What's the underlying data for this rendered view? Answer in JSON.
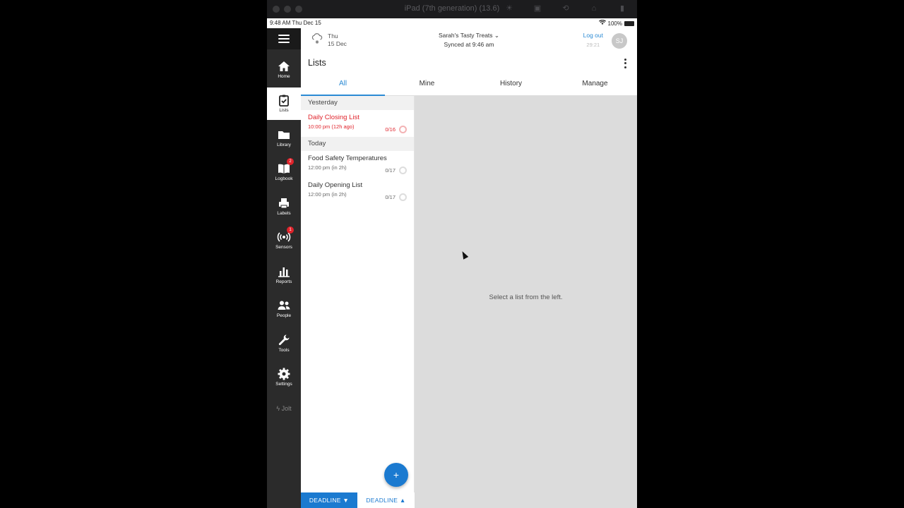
{
  "window": {
    "title": "iPad (7th generation) (13.6)"
  },
  "statusbar": {
    "time_date": "9:48 AM  Thu Dec 15",
    "battery": "100%"
  },
  "sidebar": {
    "items": [
      {
        "label": "Home",
        "icon": "home-icon"
      },
      {
        "label": "Lists",
        "icon": "clipboard-check-icon"
      },
      {
        "label": "Library",
        "icon": "folder-icon"
      },
      {
        "label": "Logbook",
        "icon": "book-icon",
        "badge": "2"
      },
      {
        "label": "Labels",
        "icon": "printer-icon"
      },
      {
        "label": "Sensors",
        "icon": "sensor-icon",
        "badge": "1"
      },
      {
        "label": "Reports",
        "icon": "bar-chart-icon"
      },
      {
        "label": "People",
        "icon": "people-icon"
      },
      {
        "label": "Tools",
        "icon": "wrench-icon"
      },
      {
        "label": "Settings",
        "icon": "gear-icon"
      }
    ],
    "brand": "Jolt"
  },
  "topbar": {
    "day": "Thu",
    "date": "15 Dec",
    "site_name": "Sarah's Tasty Treats",
    "synced": "Synced at 9:46 am",
    "logout": "Log out",
    "timer": "29:21",
    "avatar_initials": "SJ"
  },
  "page": {
    "title": "Lists"
  },
  "tabs": [
    {
      "label": "All",
      "active": true
    },
    {
      "label": "Mine",
      "active": false
    },
    {
      "label": "History",
      "active": false
    },
    {
      "label": "Manage",
      "active": false
    }
  ],
  "lists": {
    "sections": [
      {
        "heading": "Yesterday",
        "items": [
          {
            "title": "Daily Closing List",
            "subtitle": "10:00 pm (12h ago)",
            "count": "0/16",
            "overdue": true
          }
        ]
      },
      {
        "heading": "Today",
        "items": [
          {
            "title": "Food Safety Temperatures",
            "subtitle": "12:00 pm (in 2h)",
            "count": "0/17",
            "overdue": false
          },
          {
            "title": "Daily Opening List",
            "subtitle": "12:00 pm (in 2h)",
            "count": "0/17",
            "overdue": false
          }
        ]
      }
    ]
  },
  "detail": {
    "empty_message": "Select a list from the left."
  },
  "fab": {
    "label": "+"
  },
  "sort": {
    "primary": "DEADLINE ▼",
    "secondary": "DEADLINE ▲"
  },
  "colors": {
    "accent": "#1b7ad0",
    "overdue": "#e0232b",
    "sidebar": "#2b2b2b"
  }
}
